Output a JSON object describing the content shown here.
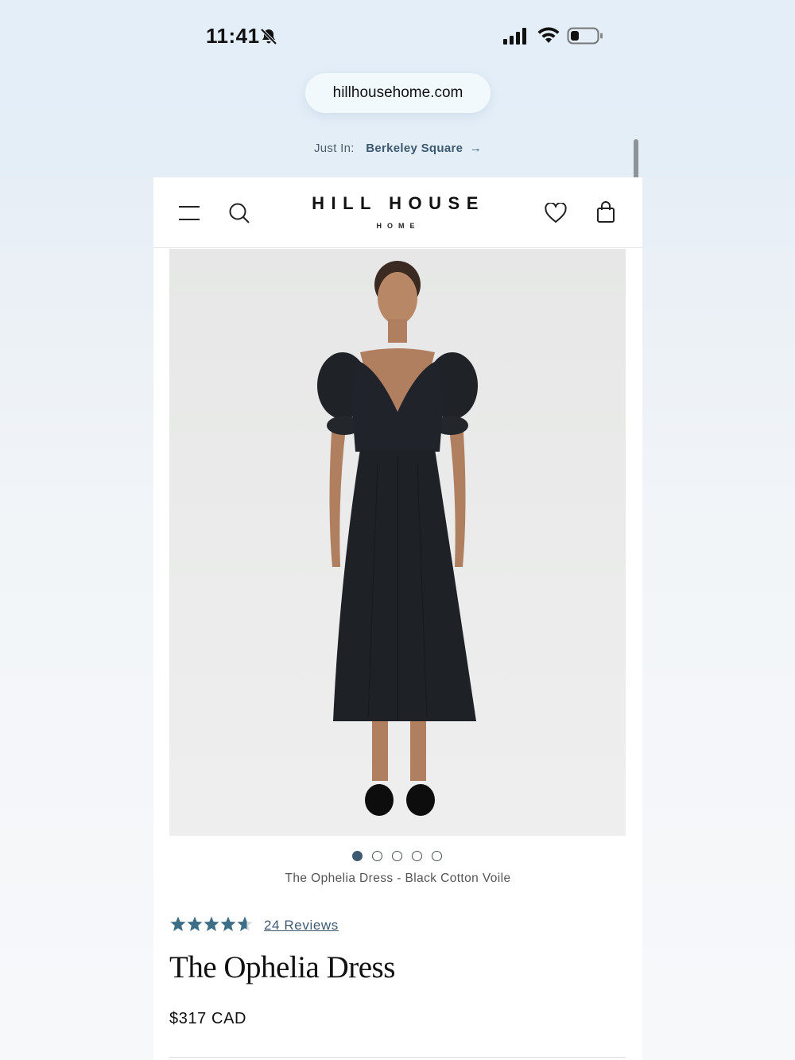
{
  "status_bar": {
    "time": "11:41",
    "icons": [
      "bell-off-icon",
      "signal-icon",
      "wifi-icon",
      "battery-icon"
    ]
  },
  "browser": {
    "url": "hillhousehome.com"
  },
  "announcement": {
    "label": "Just In:",
    "link_text": "Berkeley Square",
    "arrow": "→"
  },
  "header": {
    "logo_main": "HILL HOUSE",
    "logo_sub": "HOME",
    "icons": [
      "menu-icon",
      "search-icon",
      "heart-icon",
      "shopping-bag-icon"
    ]
  },
  "product": {
    "image_caption": "The Ophelia Dress - Black Cotton Voile",
    "carousel": {
      "total": 5,
      "active_index": 0
    },
    "rating": {
      "value": 4.4,
      "max": 5
    },
    "reviews_link": "24 Reviews",
    "title": "The Ophelia Dress",
    "price": "$317 CAD"
  },
  "colors": {
    "accent": "#3e5a70",
    "star": "#3e6e87",
    "top_bg": "#e4eef8"
  }
}
